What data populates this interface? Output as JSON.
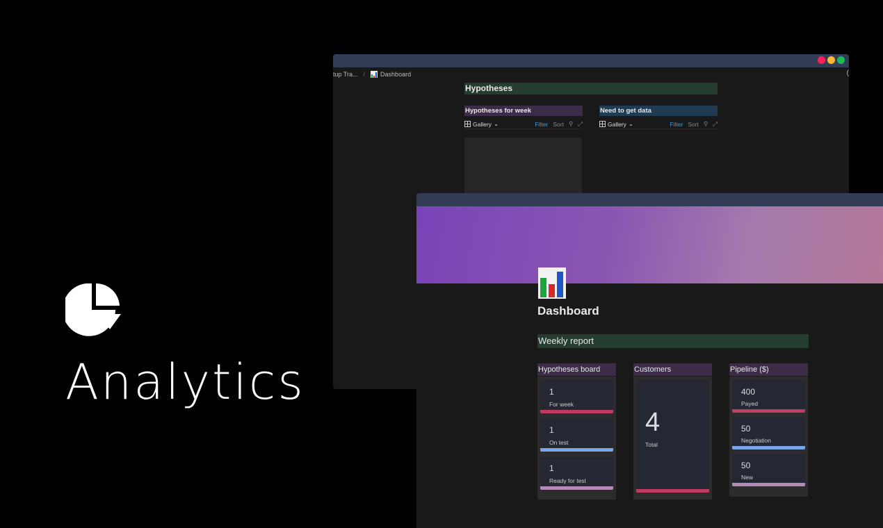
{
  "brand": {
    "title": "Analytics",
    "icon": "pie-chart-icon"
  },
  "back_window": {
    "breadcrumbs": [
      "tup Tra...",
      "Dashboard"
    ],
    "section_title": "Hypotheses",
    "boards": [
      {
        "title": "Hypotheses for week",
        "view": "Gallery",
        "filter": "Filter",
        "sort": "Sort"
      },
      {
        "title": "Need to get data",
        "view": "Gallery",
        "filter": "Filter",
        "sort": "Sort"
      }
    ],
    "right_glyph": "("
  },
  "front_window": {
    "page_title": "Dashboard",
    "section_title": "Weekly report",
    "columns": [
      {
        "title": "Hypotheses board",
        "cards": [
          {
            "value": "1",
            "label": "For week",
            "color": "#c23b63"
          },
          {
            "value": "1",
            "label": "On test",
            "color": "#7aa7e8"
          },
          {
            "value": "1",
            "label": "Ready for test",
            "color": "#b58ab8"
          }
        ]
      },
      {
        "title": "Customers",
        "cards": [
          {
            "value": "4",
            "label": "Total",
            "color": "#c23b63"
          }
        ]
      },
      {
        "title": "Pipeline ($)",
        "cards": [
          {
            "value": "400",
            "label": "Payed",
            "color": "#c23b63"
          },
          {
            "value": "50",
            "label": "Negotiation",
            "color": "#7aa7e8"
          },
          {
            "value": "50",
            "label": "New",
            "color": "#b58ab8"
          }
        ]
      }
    ]
  },
  "colors": {
    "window_titlebar": "#323c54",
    "green_header": "#253d2f",
    "purple_header": "#3d2c47",
    "blue_header": "#213c52"
  }
}
